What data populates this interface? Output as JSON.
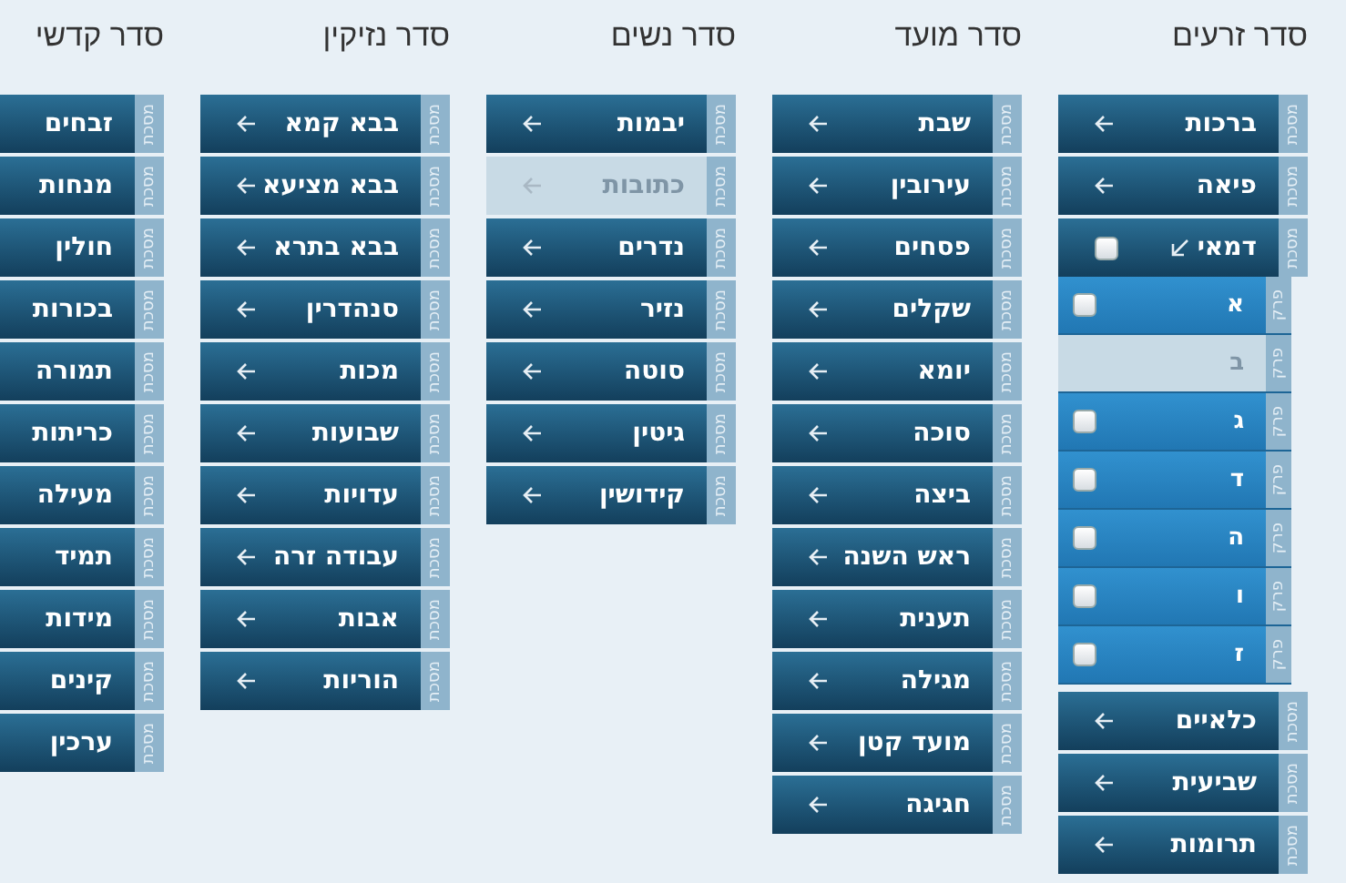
{
  "orders": [
    {
      "title": "סדר זרעים",
      "tractates": [
        {
          "name": "ברכות",
          "tab": "מסכת",
          "disabled": false,
          "expanded": false
        },
        {
          "name": "פיאה",
          "tab": "מסכת",
          "disabled": false,
          "expanded": false
        },
        {
          "name": "דמאי",
          "tab": "מסכת",
          "disabled": false,
          "expanded": true,
          "checked": false,
          "chapters": [
            {
              "name": "א",
              "tab": "פרק",
              "disabled": false,
              "checked": false
            },
            {
              "name": "ב",
              "tab": "פרק",
              "disabled": true
            },
            {
              "name": "ג",
              "tab": "פרק",
              "disabled": false,
              "checked": false
            },
            {
              "name": "ד",
              "tab": "פרק",
              "disabled": false,
              "checked": false
            },
            {
              "name": "ה",
              "tab": "פרק",
              "disabled": false,
              "checked": false
            },
            {
              "name": "ו",
              "tab": "פרק",
              "disabled": false,
              "checked": false
            },
            {
              "name": "ז",
              "tab": "פרק",
              "disabled": false,
              "checked": false
            }
          ]
        },
        {
          "name": "כלאיים",
          "tab": "מסכת",
          "disabled": false,
          "expanded": false
        },
        {
          "name": "שביעית",
          "tab": "מסכת",
          "disabled": false,
          "expanded": false
        },
        {
          "name": "תרומות",
          "tab": "מסכת",
          "disabled": false,
          "expanded": false
        }
      ]
    },
    {
      "title": "סדר מועד",
      "tractates": [
        {
          "name": "שבת",
          "tab": "מסכת",
          "disabled": false,
          "expanded": false
        },
        {
          "name": "עירובין",
          "tab": "מסכת",
          "disabled": false,
          "expanded": false
        },
        {
          "name": "פסחים",
          "tab": "מסכת",
          "disabled": false,
          "expanded": false
        },
        {
          "name": "שקלים",
          "tab": "מסכת",
          "disabled": false,
          "expanded": false
        },
        {
          "name": "יומא",
          "tab": "מסכת",
          "disabled": false,
          "expanded": false
        },
        {
          "name": "סוכה",
          "tab": "מסכת",
          "disabled": false,
          "expanded": false
        },
        {
          "name": "ביצה",
          "tab": "מסכת",
          "disabled": false,
          "expanded": false
        },
        {
          "name": "ראש השנה",
          "tab": "מסכת",
          "disabled": false,
          "expanded": false
        },
        {
          "name": "תענית",
          "tab": "מסכת",
          "disabled": false,
          "expanded": false
        },
        {
          "name": "מגילה",
          "tab": "מסכת",
          "disabled": false,
          "expanded": false
        },
        {
          "name": "מועד קטן",
          "tab": "מסכת",
          "disabled": false,
          "expanded": false
        },
        {
          "name": "חגיגה",
          "tab": "מסכת",
          "disabled": false,
          "expanded": false
        }
      ]
    },
    {
      "title": "סדר נשים",
      "tractates": [
        {
          "name": "יבמות",
          "tab": "מסכת",
          "disabled": false,
          "expanded": false
        },
        {
          "name": "כתובות",
          "tab": "מסכת",
          "disabled": true,
          "expanded": false
        },
        {
          "name": "נדרים",
          "tab": "מסכת",
          "disabled": false,
          "expanded": false
        },
        {
          "name": "נזיר",
          "tab": "מסכת",
          "disabled": false,
          "expanded": false
        },
        {
          "name": "סוטה",
          "tab": "מסכת",
          "disabled": false,
          "expanded": false
        },
        {
          "name": "גיטין",
          "tab": "מסכת",
          "disabled": false,
          "expanded": false
        },
        {
          "name": "קידושין",
          "tab": "מסכת",
          "disabled": false,
          "expanded": false
        }
      ]
    },
    {
      "title": "סדר נזיקין",
      "tractates": [
        {
          "name": "בבא קמא",
          "tab": "מסכת",
          "disabled": false,
          "expanded": false
        },
        {
          "name": "בבא מציעא",
          "tab": "מסכת",
          "disabled": false,
          "expanded": false
        },
        {
          "name": "בבא בתרא",
          "tab": "מסכת",
          "disabled": false,
          "expanded": false
        },
        {
          "name": "סנהדרין",
          "tab": "מסכת",
          "disabled": false,
          "expanded": false
        },
        {
          "name": "מכות",
          "tab": "מסכת",
          "disabled": false,
          "expanded": false
        },
        {
          "name": "שבועות",
          "tab": "מסכת",
          "disabled": false,
          "expanded": false
        },
        {
          "name": "עדויות",
          "tab": "מסכת",
          "disabled": false,
          "expanded": false
        },
        {
          "name": "עבודה זרה",
          "tab": "מסכת",
          "disabled": false,
          "expanded": false
        },
        {
          "name": "אבות",
          "tab": "מסכת",
          "disabled": false,
          "expanded": false
        },
        {
          "name": "הוריות",
          "tab": "מסכת",
          "disabled": false,
          "expanded": false
        }
      ]
    },
    {
      "title": "סדר קדשי",
      "tractates": [
        {
          "name": "זבחים",
          "tab": "מסכת",
          "disabled": false,
          "expanded": false
        },
        {
          "name": "מנחות",
          "tab": "מסכת",
          "disabled": false,
          "expanded": false
        },
        {
          "name": "חולין",
          "tab": "מסכת",
          "disabled": false,
          "expanded": false
        },
        {
          "name": "בכורות",
          "tab": "מסכת",
          "disabled": false,
          "expanded": false
        },
        {
          "name": "תמורה",
          "tab": "מסכת",
          "disabled": false,
          "expanded": false
        },
        {
          "name": "כריתות",
          "tab": "מסכת",
          "disabled": false,
          "expanded": false
        },
        {
          "name": "מעילה",
          "tab": "מסכת",
          "disabled": false,
          "expanded": false
        },
        {
          "name": "תמיד",
          "tab": "מסכת",
          "disabled": false,
          "expanded": false
        },
        {
          "name": "מידות",
          "tab": "מסכת",
          "disabled": false,
          "expanded": false
        },
        {
          "name": "קינים",
          "tab": "מסכת",
          "disabled": false,
          "expanded": false
        },
        {
          "name": "ערכין",
          "tab": "מסכת",
          "disabled": false,
          "expanded": false
        }
      ]
    }
  ]
}
